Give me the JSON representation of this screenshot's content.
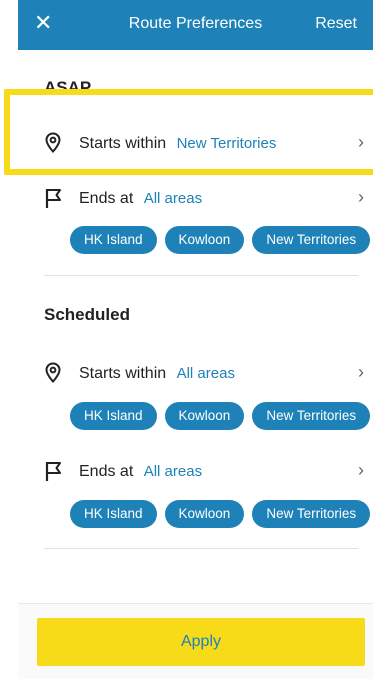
{
  "header": {
    "close_icon": "close-icon",
    "title": "Route Preferences",
    "reset_label": "Reset"
  },
  "asap": {
    "title": "ASAP",
    "starts": {
      "label": "Starts within",
      "value": "New Territories"
    },
    "ends": {
      "label": "Ends at",
      "value": "All areas",
      "chips": [
        "HK Island",
        "Kowloon",
        "New Territories"
      ]
    }
  },
  "scheduled": {
    "title": "Scheduled",
    "starts": {
      "label": "Starts within",
      "value": "All areas",
      "chips": [
        "HK Island",
        "Kowloon",
        "New Territories"
      ]
    },
    "ends": {
      "label": "Ends at",
      "value": "All areas",
      "chips": [
        "HK Island",
        "Kowloon",
        "New Territories"
      ]
    }
  },
  "footer": {
    "apply_label": "Apply"
  },
  "colors": {
    "accent": "#1e82b8",
    "highlight": "#f7db18"
  }
}
